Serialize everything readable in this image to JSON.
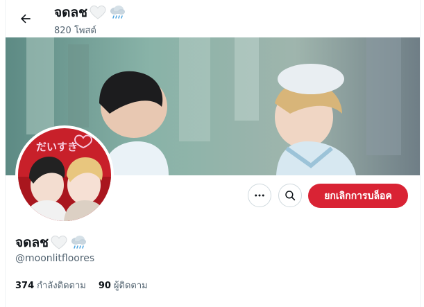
{
  "header": {
    "display_name": "จดลช",
    "post_count": "820 โพสต์",
    "back_icon": "arrow-left-icon"
  },
  "profile": {
    "display_name": "จดลช",
    "handle": "@moonlitfloores",
    "emoji_icons": [
      "white-heart-icon",
      "rain-cloud-icon"
    ],
    "avatar_text": "だいすき"
  },
  "actions": {
    "more_icon": "more-horizontal-icon",
    "search_icon": "search-icon",
    "unblock_label": "ยกเลิกการบล็อค"
  },
  "stats": {
    "following_count": "374",
    "following_label": "กำลังติดตาม",
    "followers_count": "90",
    "followers_label": "ผู้ติดตาม"
  },
  "colors": {
    "unblock_bg": "#d92334",
    "secondary_text": "#536471",
    "border": "#cfd9de"
  }
}
